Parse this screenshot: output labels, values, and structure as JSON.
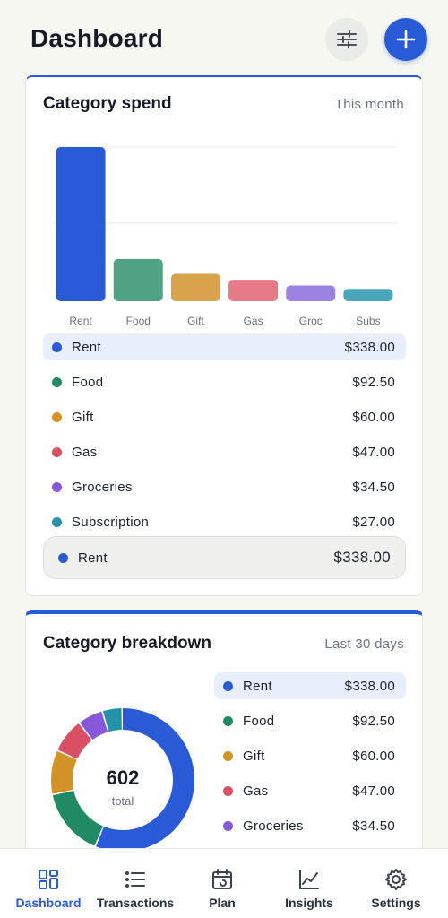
{
  "header": {
    "title": "Dashboard",
    "filter_icon": "sliders-icon",
    "add_icon": "plus-icon"
  },
  "category_spend": {
    "title": "Category spend",
    "period": "This month",
    "legend": [
      {
        "label": "Rent",
        "value": "$338.00",
        "color": "#2a5bd7",
        "active": true
      },
      {
        "label": "Food",
        "value": "$92.50",
        "color": "#1f8a63",
        "active": false
      },
      {
        "label": "Gift",
        "value": "$60.00",
        "color": "#d39225",
        "active": false
      },
      {
        "label": "Gas",
        "value": "$47.00",
        "color": "#d94f64",
        "active": false
      },
      {
        "label": "Groceries",
        "value": "$34.50",
        "color": "#8559d9",
        "active": false
      },
      {
        "label": "Subscription",
        "value": "$27.00",
        "color": "#2592a8",
        "active": false
      }
    ],
    "selected": {
      "label": "Rent",
      "value": "$338.00",
      "color": "#2a5bd7"
    }
  },
  "category_breakdown": {
    "title": "Category breakdown",
    "period": "Last 30 days",
    "total_value": "602",
    "total_label": "total",
    "legend": [
      {
        "label": "Rent",
        "value": "$338.00",
        "color": "#2a5bd7",
        "active": true
      },
      {
        "label": "Food",
        "value": "$92.50",
        "color": "#1f8a63",
        "active": false
      },
      {
        "label": "Gift",
        "value": "$60.00",
        "color": "#d39225",
        "active": false
      },
      {
        "label": "Gas",
        "value": "$47.00",
        "color": "#d94f64",
        "active": false
      },
      {
        "label": "Groceries",
        "value": "$34.50",
        "color": "#8559d9",
        "active": false
      }
    ]
  },
  "chart_data": [
    {
      "type": "bar",
      "categories": [
        "Rent",
        "Food",
        "Gift",
        "Gas",
        "Groc",
        "Subs"
      ],
      "values": [
        338,
        92.5,
        60,
        47,
        34.5,
        27
      ],
      "colors": [
        "#2a5bd7",
        "#4fa283",
        "#d9a34b",
        "#e77a87",
        "#9a83e0",
        "#4aa6ba"
      ],
      "title": "Category spend",
      "grid": true,
      "ylim": [
        0,
        338
      ]
    },
    {
      "type": "pie",
      "categories": [
        "Rent",
        "Food",
        "Gift",
        "Gas",
        "Groceries",
        "Subscription"
      ],
      "values": [
        338,
        92.5,
        60,
        47,
        34.5,
        27
      ],
      "colors": [
        "#2a5bd7",
        "#1f8a63",
        "#d39225",
        "#d94f64",
        "#8559d9",
        "#2592a8"
      ],
      "title": "Category breakdown"
    }
  ],
  "nav": {
    "items": [
      {
        "label": "Dashboard",
        "icon": "dashboard-icon",
        "active": true
      },
      {
        "label": "Transactions",
        "icon": "list-icon",
        "active": false
      },
      {
        "label": "Plan",
        "icon": "calendar-refresh-icon",
        "active": false
      },
      {
        "label": "Insights",
        "icon": "line-chart-icon",
        "active": false
      },
      {
        "label": "Settings",
        "icon": "gear-icon",
        "active": false
      }
    ]
  }
}
